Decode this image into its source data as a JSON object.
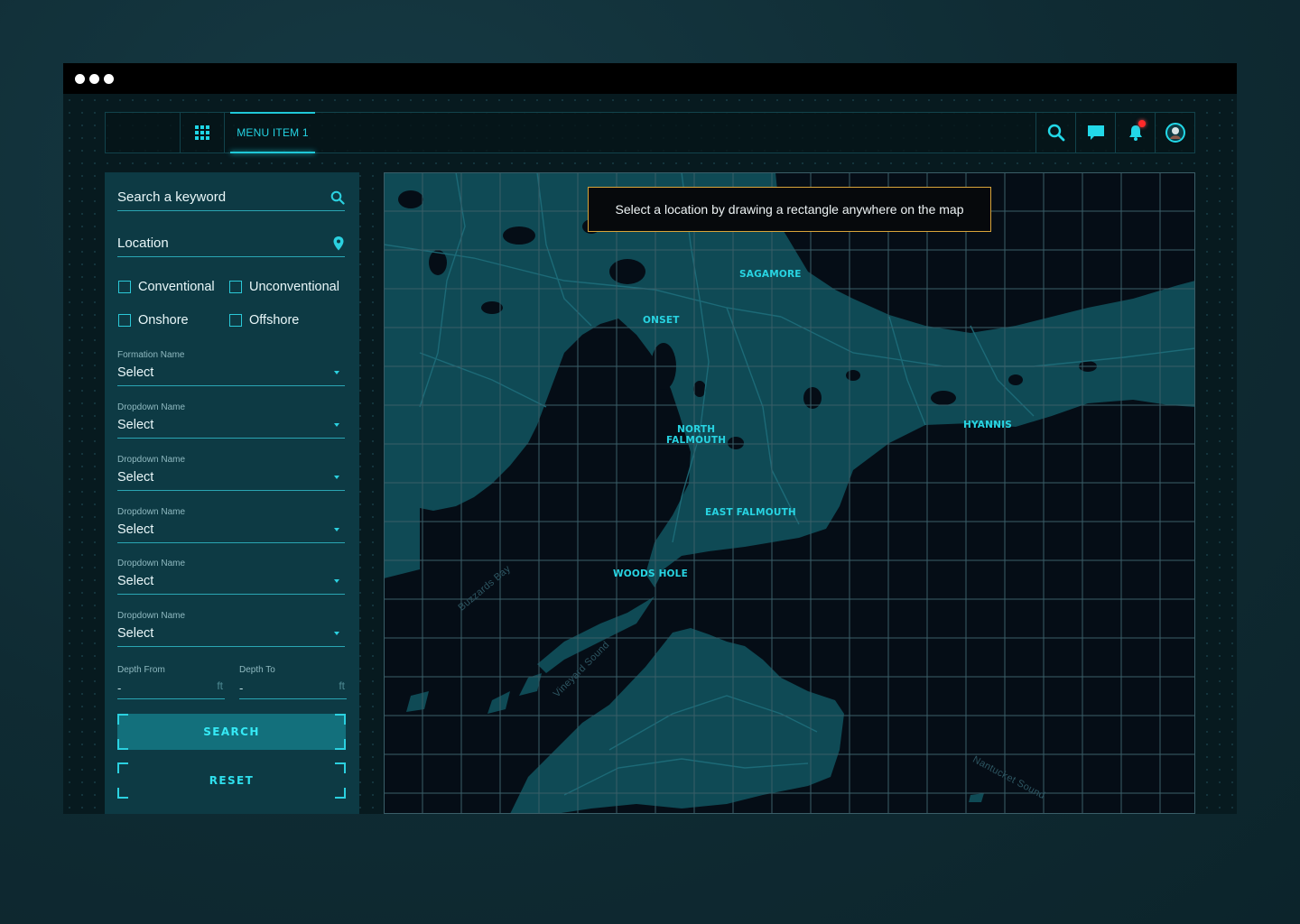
{
  "header": {
    "menu_item": "MENU ITEM 1",
    "icons": [
      "grid-icon",
      "search-icon",
      "chat-icon",
      "bell-icon",
      "avatar"
    ]
  },
  "sidebar": {
    "keyword": {
      "placeholder": "Search a keyword",
      "icon": "search-icon"
    },
    "location": {
      "placeholder": "Location",
      "icon": "map-pin-icon"
    },
    "checkboxes": [
      "Conventional",
      "Unconventional",
      "Onshore",
      "Offshore"
    ],
    "dropdowns": [
      {
        "label": "Formation Name",
        "value": "Select"
      },
      {
        "label": "Dropdown Name",
        "value": "Select"
      },
      {
        "label": "Dropdown Name",
        "value": "Select"
      },
      {
        "label": "Dropdown Name",
        "value": "Select"
      },
      {
        "label": "Dropdown Name",
        "value": "Select"
      },
      {
        "label": "Dropdown Name",
        "value": "Select"
      }
    ],
    "depth_from": {
      "label": "Depth From",
      "value": "-",
      "unit": "ft"
    },
    "depth_to": {
      "label": "Depth To",
      "value": "-",
      "unit": "ft"
    },
    "search_button": "SEARCH",
    "reset_button": "RESET"
  },
  "map": {
    "hint": "Select a location by drawing a rectangle anywhere on the map",
    "places": {
      "sagamore": "SAGAMORE",
      "onset": "ONSET",
      "north_falmouth_1": "NORTH",
      "north_falmouth_2": "FALMOUTH",
      "hyannis": "HYANNIS",
      "east_falmouth": "EAST FALMOUTH",
      "woods_hole": "WOODS HOLE"
    },
    "water": {
      "buzzards_bay": "Buzzards Bay",
      "vineyard_sound": "Vineyard Sound",
      "nantucket_sound": "Nantucket Sound"
    }
  },
  "colors": {
    "accent": "#1fd6e6",
    "land": "#0f4a55",
    "tooltip_border": "#d9a43a",
    "badge": "#ff2a2a"
  }
}
